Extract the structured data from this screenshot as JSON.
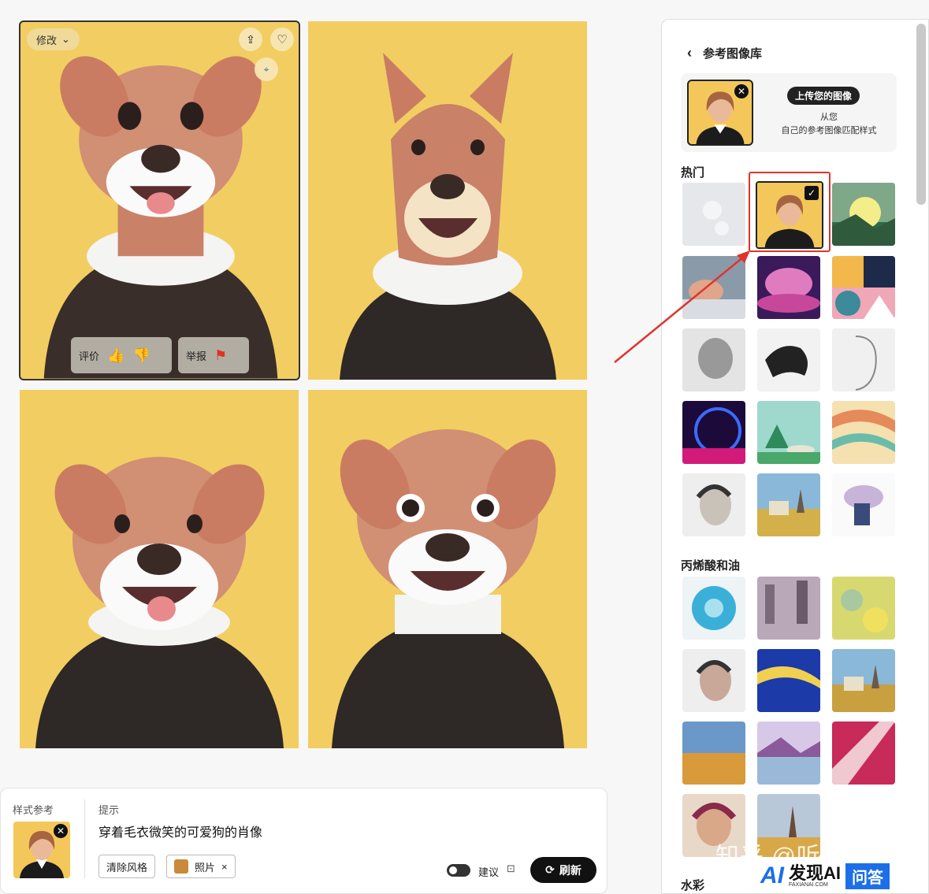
{
  "grid": {
    "edit_label": "修改",
    "rate_label": "评价",
    "report_label": "举报"
  },
  "panel": {
    "title": "参考图像库",
    "upload_button": "上传您的图像",
    "upload_desc_line1": "从您",
    "upload_desc_line2": "自己的参考图像匹配样式",
    "section_popular": "热门",
    "section_acrylic": "丙烯酸和油",
    "section_watercolor": "水彩"
  },
  "prompt": {
    "style_ref_label": "样式参考",
    "hint_label": "提示",
    "prompt_text": "穿着毛衣微笑的可爱狗的肖像",
    "clear_style": "清除风格",
    "photo_chip": "照片",
    "suggest_label": "建议",
    "refresh_label": "刷新"
  },
  "watermark": {
    "text": "知乎 @听雨AGI",
    "brand": "发现AI",
    "brand_sub": "FAXIANAI.COM",
    "qa": "问答"
  },
  "colors": {
    "tile_bg": "#f2cd62",
    "highlight": "#e0332c",
    "brand_blue": "#1c6fe8"
  }
}
